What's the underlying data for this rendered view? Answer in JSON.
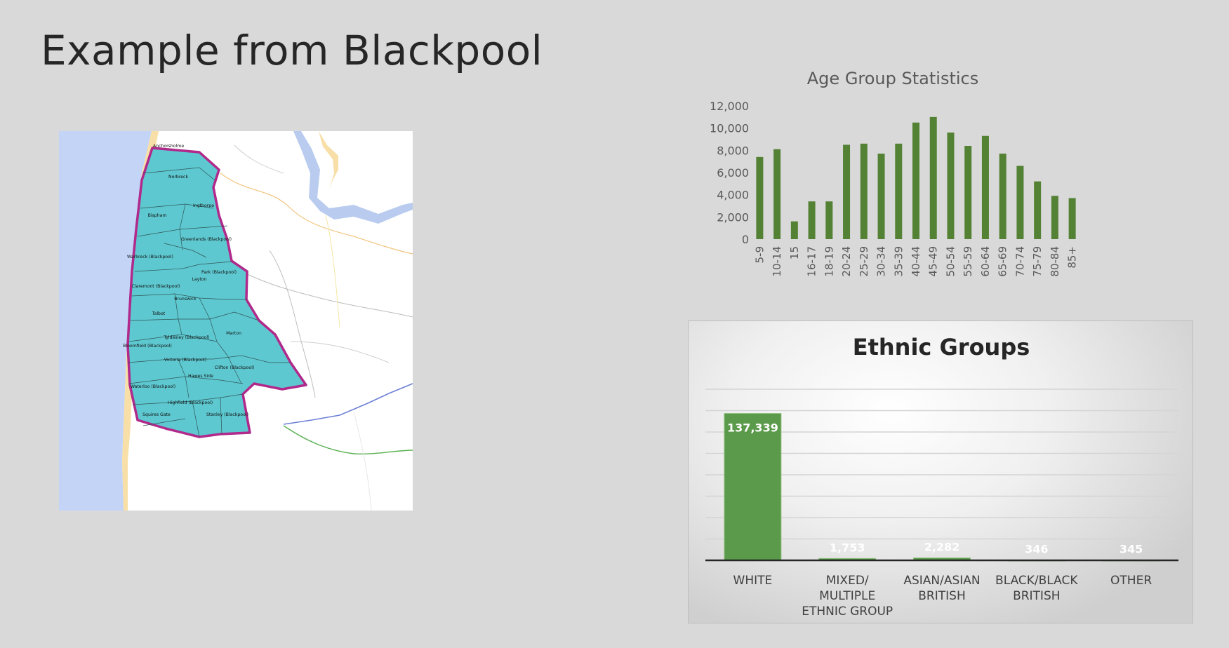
{
  "slide": {
    "title": "Example from Blackpool"
  },
  "map": {
    "wards": [
      "Anchorsholme",
      "Norbreck",
      "Ingthorpe",
      "Bispham",
      "Greenlands (Blackpool)",
      "Warbreck (Blackpool)",
      "Park (Blackpool)",
      "Layton",
      "Claremont (Blackpool)",
      "Brunswick",
      "Talbot",
      "Marton",
      "Tyldesley (Blackpool)",
      "Bloomfield (Blackpool)",
      "Victoria (Blackpool)",
      "Clifton (Blackpool)",
      "Hawes Side",
      "Waterloo (Blackpool)",
      "Highfield (Blackpool)",
      "Squires Gate",
      "Stanley (Blackpool)"
    ],
    "colors": {
      "sea": "#c3d4f7",
      "beach": "#f7dfa7",
      "wards_fill": "#5ec8d0",
      "boundary": "#b0298b",
      "land": "#ffffff"
    }
  },
  "chart_data": [
    {
      "type": "bar",
      "title": "Age Group Statistics",
      "categories": [
        "5-9",
        "10-14",
        "15",
        "16-17",
        "18-19",
        "20-24",
        "25-29",
        "30-34",
        "35-39",
        "40-44",
        "45-49",
        "50-54",
        "55-59",
        "60-64",
        "65-69",
        "70-74",
        "75-79",
        "80-84",
        "85+"
      ],
      "values": [
        7400,
        8100,
        1600,
        3400,
        3400,
        8500,
        8600,
        7700,
        8600,
        10500,
        11000,
        9600,
        8400,
        9300,
        7700,
        6600,
        5200,
        3900,
        3700
      ],
      "ylim": [
        0,
        12000
      ],
      "yticks": [
        "12,000",
        "10,000",
        "8,000",
        "6,000",
        "4,000",
        "2,000",
        "0"
      ],
      "ytick_values": [
        12000,
        10000,
        8000,
        6000,
        4000,
        2000,
        0
      ],
      "color": "#548235",
      "grid": false,
      "legend": "none"
    },
    {
      "type": "bar",
      "title": "Ethnic Groups",
      "categories": [
        [
          "WHITE"
        ],
        [
          "MIXED/",
          "MULTIPLE",
          "ETHNIC GROUP"
        ],
        [
          "ASIAN/ASIAN",
          "BRITISH"
        ],
        [
          "BLACK/BLACK",
          "BRITISH"
        ],
        [
          "OTHER"
        ]
      ],
      "values": [
        137339,
        1753,
        2282,
        346,
        345
      ],
      "data_labels": [
        "137,339",
        "1,753",
        "2,282",
        "346",
        "345"
      ],
      "ylim": [
        0,
        160000
      ],
      "gridline_values": [
        20000,
        40000,
        60000,
        80000,
        100000,
        120000,
        140000,
        160000
      ],
      "color": "#5b9a4b",
      "grid": true,
      "legend": "none"
    }
  ]
}
